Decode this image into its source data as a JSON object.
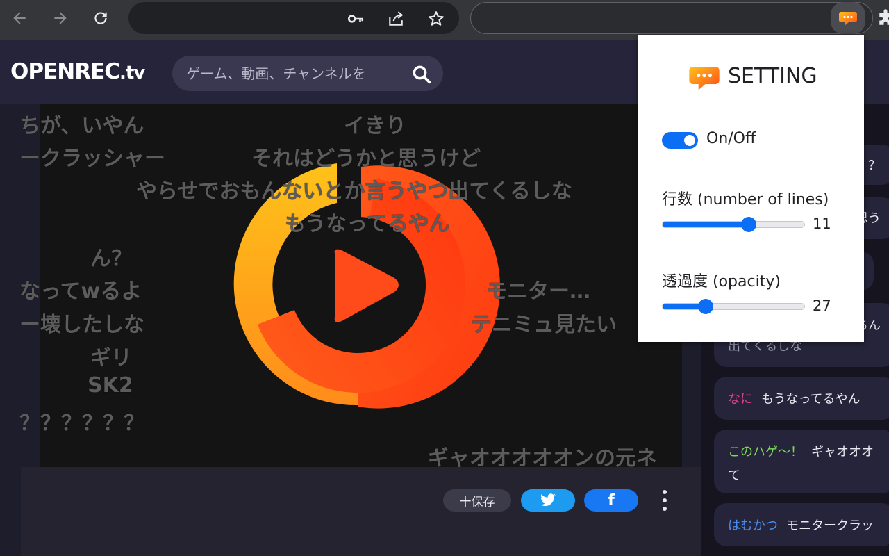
{
  "browser": {
    "back_icon": "arrow-left-icon",
    "forward_icon": "arrow-right-icon",
    "reload_icon": "reload-icon",
    "key_icon": "key-icon",
    "share_icon": "share-icon",
    "star_icon": "star-icon",
    "extension_icon": "chat-bubble-icon",
    "puzzle_icon": "puzzle-icon"
  },
  "site": {
    "logo_main": "OPENREC",
    "logo_tv": ".tv",
    "search_placeholder": "ゲーム、動画、チャンネルを"
  },
  "overlay_comments": [
    "ちが、いやん",
    "イきり",
    "ークラッシャー",
    "それはどうかと思うけど",
    "やらせでおもんないとか言うやつ出てくるしな",
    "もうなってるやん",
    "ん？",
    "なってwるよ",
    "モニター…",
    "ー壊したしな",
    "テニミュ見たい",
    "ギリ",
    "SK2",
    "？？？？？？",
    "ギャオオオオオンの元ネ"
  ],
  "actions": {
    "save_label": "十保存",
    "twitter_icon": "twitter-icon",
    "facebook_label": "f",
    "more_icon": "more-vertical-icon"
  },
  "chat": [
    {
      "user": "",
      "text": "？？",
      "user_color": "#e8e8ef"
    },
    {
      "user": "",
      "text": "思う",
      "user_color": "#e8e8ef"
    },
    {
      "user": "",
      "text": "",
      "user_color": "#e8e8ef"
    },
    {
      "user": "",
      "text": "ちん",
      "text2": "出てくるしな",
      "user_color": "#e8e8ef"
    },
    {
      "user": "なに",
      "text": "もうなってるやん",
      "user_color": "#e0458b"
    },
    {
      "user": "このハゲ～！",
      "text": "ギャオオオ",
      "text2": "て",
      "user_color": "#7ed957"
    },
    {
      "user": "はむかつ",
      "text": "モニタークラッ",
      "user_color": "#4a8ff0"
    }
  ],
  "popup": {
    "title": "SETTING",
    "toggle_label": "On/Off",
    "toggle_on": true,
    "lines_label": "行数 (number of lines)",
    "lines_value": "11",
    "lines_fraction": 0.6,
    "opacity_label": "透過度 (opacity)",
    "opacity_value": "27",
    "opacity_fraction": 0.3,
    "accent": "#0b6ef5"
  }
}
